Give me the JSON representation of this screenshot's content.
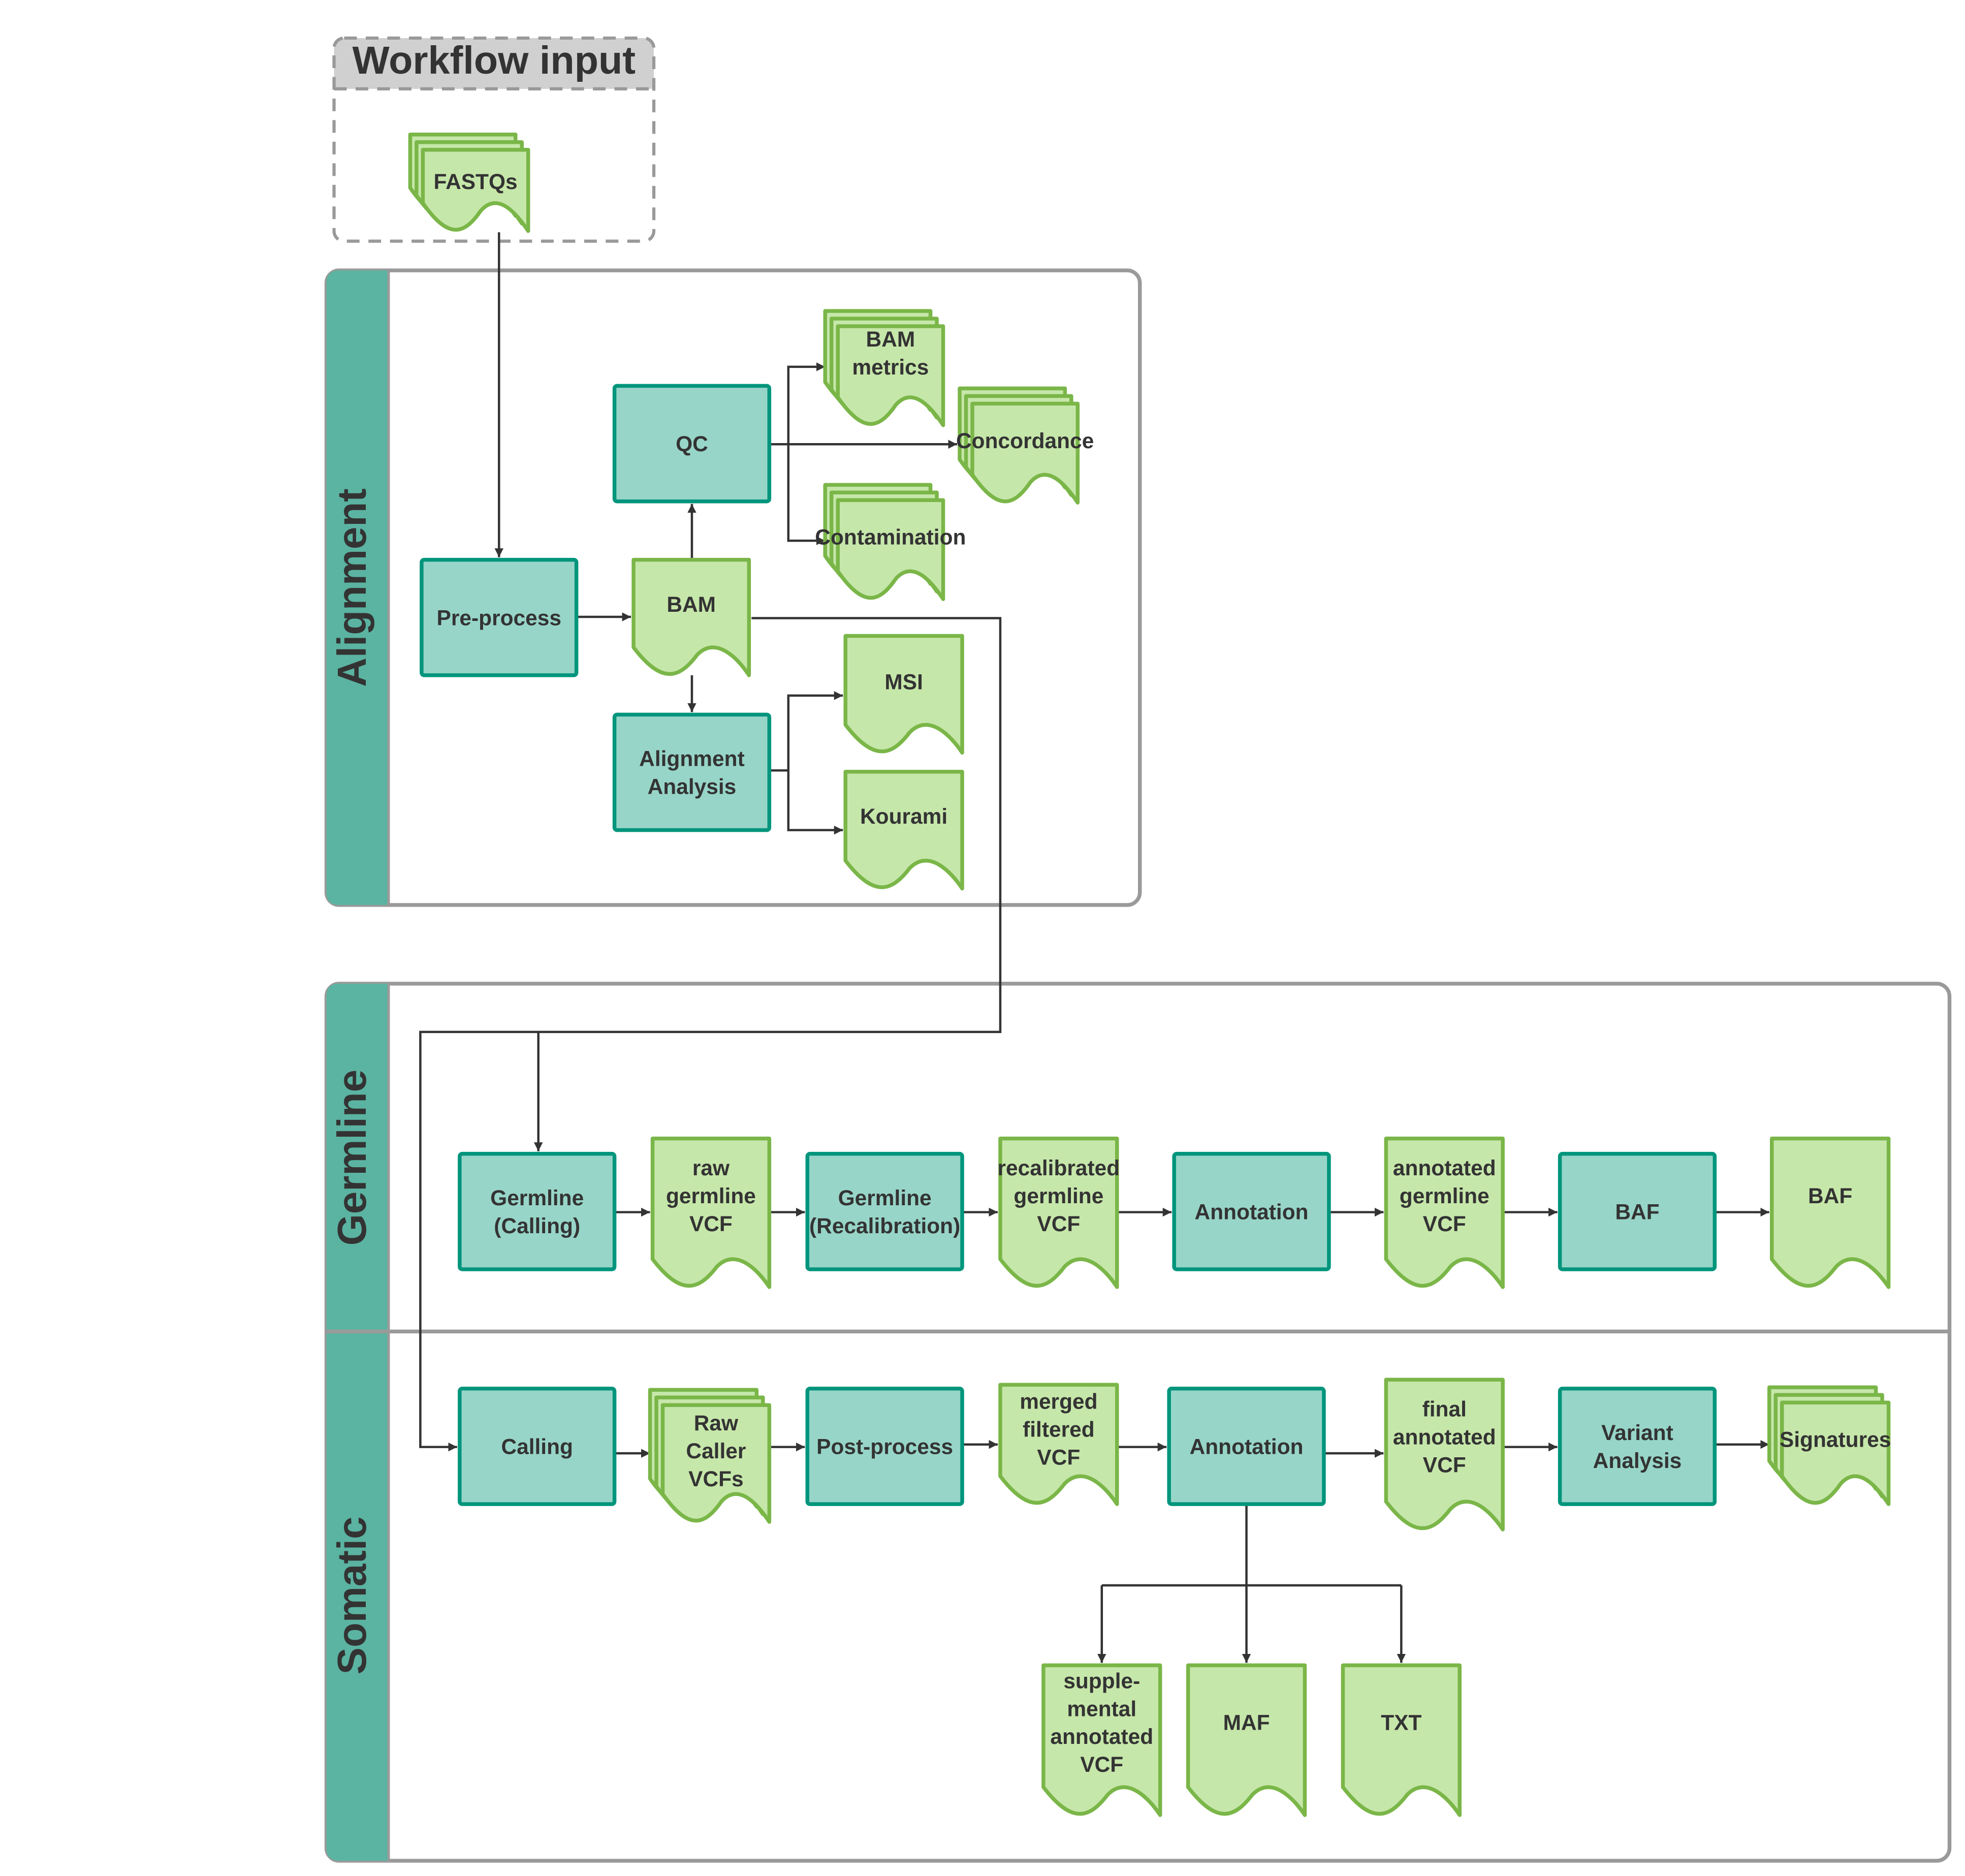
{
  "colors": {
    "process_fill": "#97d5c8",
    "process_stroke": "#00957c",
    "doc_fill": "#c6e7aa",
    "doc_stroke": "#7ab648",
    "lane_stripe": "#5bb3a1",
    "lane_border": "#9a9a9a",
    "connector": "#333333"
  },
  "workflow_input": {
    "title": "Workflow input",
    "fastqs": [
      "FASTQs"
    ]
  },
  "lanes": {
    "alignment": "Alignment",
    "germline": "Germline",
    "somatic": "Somatic"
  },
  "alignment": {
    "preprocess": [
      "Pre-process"
    ],
    "bam": [
      "BAM"
    ],
    "qc": [
      "QC"
    ],
    "alignment_analysis": [
      "Alignment",
      "Analysis"
    ],
    "bam_metrics": [
      "BAM",
      "metrics"
    ],
    "concordance": [
      "Concordance"
    ],
    "contamination": [
      "Contamination"
    ],
    "msi": [
      "MSI"
    ],
    "kourami": [
      "Kourami"
    ]
  },
  "germline": {
    "calling": [
      "Germline",
      "(Calling)"
    ],
    "raw_vcf": [
      "raw",
      "germline",
      "VCF"
    ],
    "recalibration": [
      "Germline",
      "(Recalibration)"
    ],
    "recalibrated_vcf": [
      "recalibrated",
      "germline",
      "VCF"
    ],
    "annotation": [
      "Annotation"
    ],
    "annotated_vcf": [
      "annotated",
      "germline",
      "VCF"
    ],
    "baf_process": [
      "BAF"
    ],
    "baf_output": [
      "BAF"
    ]
  },
  "somatic": {
    "calling": [
      "Calling"
    ],
    "raw_caller_vcfs": [
      "Raw",
      "Caller",
      "VCFs"
    ],
    "postprocess": [
      "Post-process"
    ],
    "merged_filtered_vcf": [
      "merged",
      "filtered",
      "VCF"
    ],
    "annotation": [
      "Annotation"
    ],
    "final_annotated_vcf": [
      "final",
      "annotated",
      "VCF"
    ],
    "variant_analysis": [
      "Variant",
      "Analysis"
    ],
    "signatures": [
      "Signatures"
    ],
    "supplemental_vcf": [
      "supple-",
      "mental",
      "annotated",
      "VCF"
    ],
    "maf": [
      "MAF"
    ],
    "txt": [
      "TXT"
    ]
  }
}
